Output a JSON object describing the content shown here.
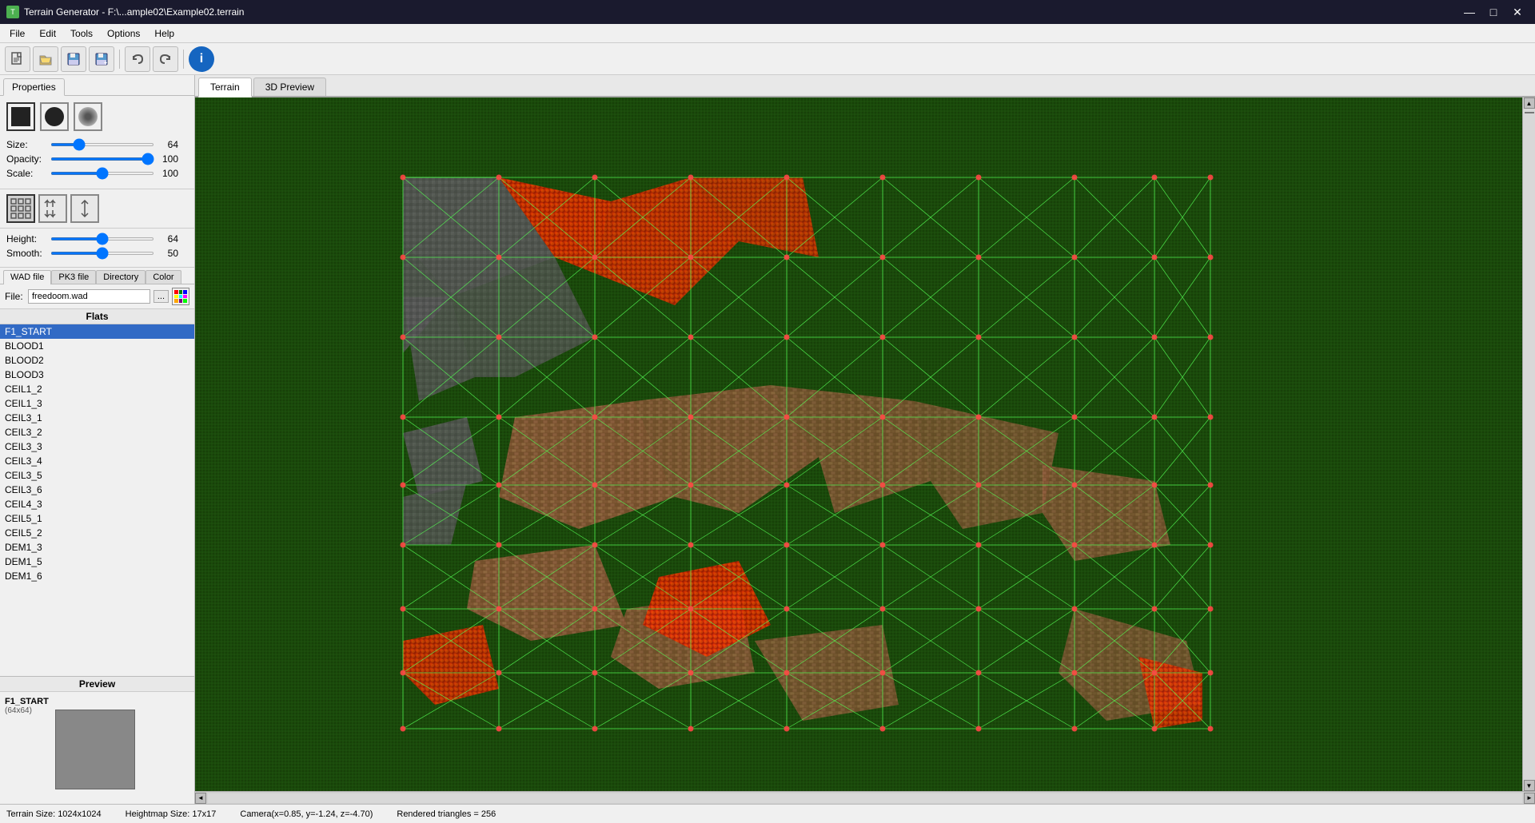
{
  "window": {
    "title": "Terrain Generator - F:\\...ample02\\Example02.terrain",
    "icon": "T"
  },
  "menubar": {
    "items": [
      "File",
      "Edit",
      "Tools",
      "Options",
      "Help"
    ]
  },
  "toolbar": {
    "new_tooltip": "New",
    "open_tooltip": "Open",
    "save_tooltip": "Save",
    "saveas_tooltip": "Save As",
    "undo_tooltip": "Undo",
    "redo_tooltip": "Redo",
    "info_tooltip": "Info"
  },
  "properties_tab": {
    "label": "Properties"
  },
  "brushes": [
    {
      "id": "square",
      "label": "Square brush"
    },
    {
      "id": "circle",
      "label": "Circle brush"
    },
    {
      "id": "soft",
      "label": "Soft circle brush"
    }
  ],
  "sliders": {
    "size": {
      "label": "Size:",
      "value": 64,
      "min": 1,
      "max": 256,
      "pct": 50
    },
    "opacity": {
      "label": "Opacity:",
      "value": 100,
      "min": 0,
      "max": 100,
      "pct": 100
    },
    "scale": {
      "label": "Scale:",
      "value": 100,
      "min": 0,
      "max": 200,
      "pct": 50
    }
  },
  "tool_modes": [
    {
      "id": "pattern",
      "icon": "⊞",
      "label": "Pattern mode"
    },
    {
      "id": "updown",
      "icon": "⇅",
      "label": "Up/Down mode"
    },
    {
      "id": "arrows",
      "icon": "↕",
      "label": "Smooth mode"
    }
  ],
  "height_smooth": {
    "height_label": "Height:",
    "height_value": 64,
    "height_pct": 50,
    "smooth_label": "Smooth:",
    "smooth_value": 50,
    "smooth_pct": 50
  },
  "texture_tabs": {
    "items": [
      "WAD file",
      "PK3 file",
      "Directory",
      "Color"
    ],
    "active": "WAD file"
  },
  "file": {
    "label": "File:",
    "value": "freedoom.wad",
    "browse": "..."
  },
  "flats": {
    "header": "Flats",
    "items": [
      "F1_START",
      "BLOOD1",
      "BLOOD2",
      "BLOOD3",
      "CEIL1_2",
      "CEIL1_3",
      "CEIL3_1",
      "CEIL3_2",
      "CEIL3_3",
      "CEIL3_4",
      "CEIL3_5",
      "CEIL3_6",
      "CEIL4_3",
      "CEIL5_1",
      "CEIL5_2",
      "DEM1_3",
      "DEM1_5",
      "DEM1_6"
    ],
    "selected": "F1_START"
  },
  "preview": {
    "header": "Preview",
    "name": "F1_START",
    "size": "(64x64)"
  },
  "view_tabs": {
    "items": [
      "Terrain",
      "3D Preview"
    ],
    "active": "Terrain"
  },
  "statusbar": {
    "terrain_size": "Terrain Size: 1024x1024",
    "heightmap_size": "Heightmap Size: 17x17",
    "camera": "Camera(x=0.85, y=-1.24, z=-4.70)",
    "triangles": "Rendered triangles = 256"
  }
}
